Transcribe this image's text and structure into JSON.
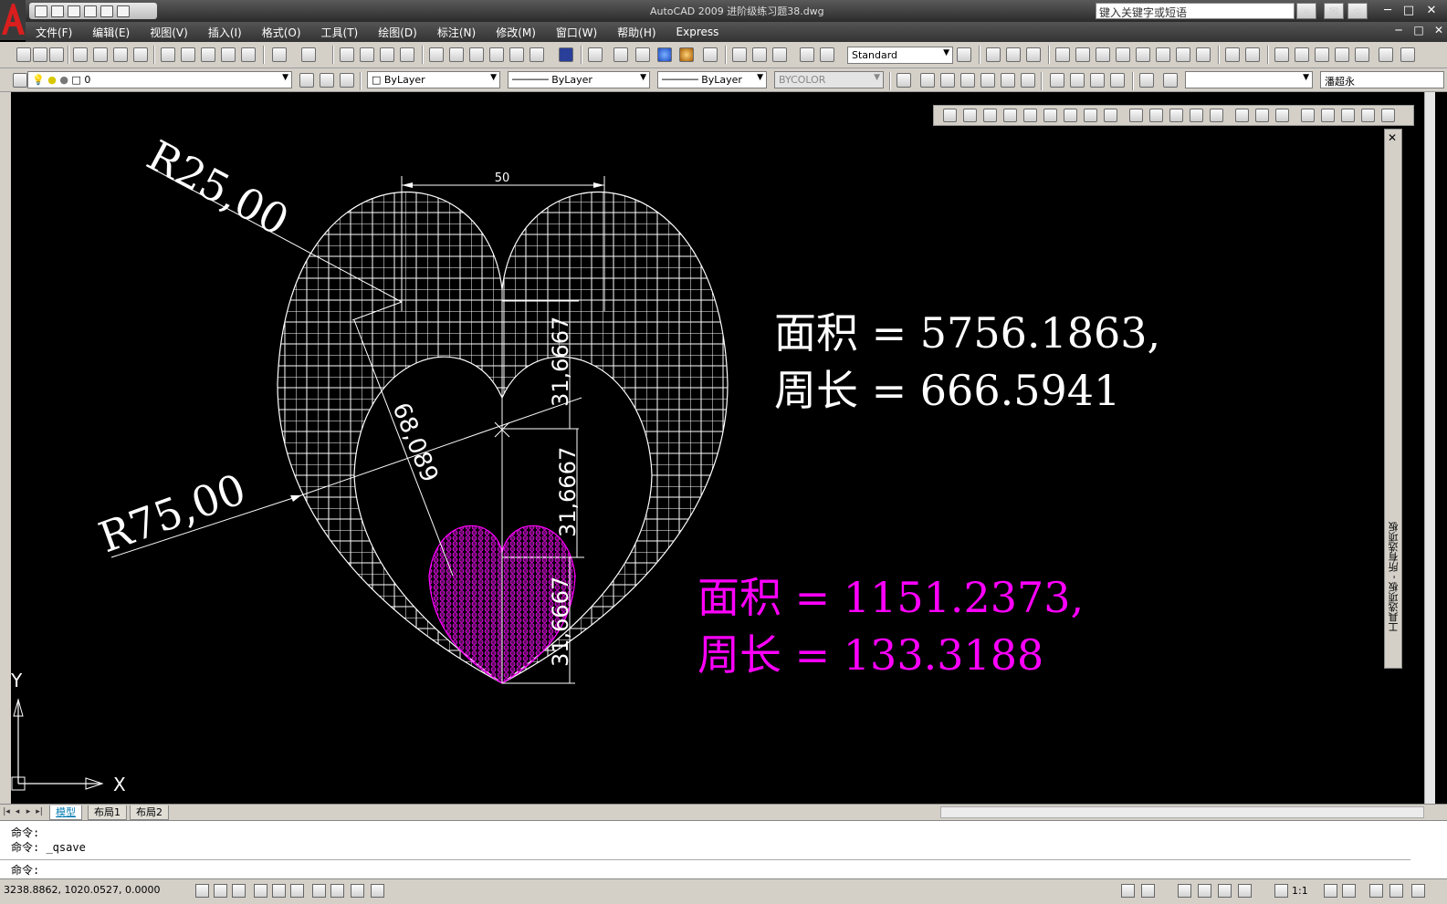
{
  "window": {
    "title": "AutoCAD 2009  进阶级练习题38.dwg",
    "search_placeholder": "键入关键字或短语",
    "min_symbol": "─",
    "max_symbol": "□",
    "close_symbol": "✕"
  },
  "menu": {
    "items": [
      "文件(F)",
      "编辑(E)",
      "视图(V)",
      "插入(I)",
      "格式(O)",
      "工具(T)",
      "绘图(D)",
      "标注(N)",
      "修改(M)",
      "窗口(W)",
      "帮助(H)",
      "Express"
    ]
  },
  "toolbar": {
    "text_style": "Standard",
    "layer": "0",
    "color": "ByLayer",
    "linetype": "ByLayer",
    "lineweight": "ByLayer",
    "plotstyle": "BYCOLOR",
    "user_field": "潘超永"
  },
  "palette": {
    "title": "工具选项板 - 所有选项板"
  },
  "drawing": {
    "dimensions": {
      "top_width": "50",
      "r_small": "R25,00",
      "r_large": "R75,00",
      "diag": "68,089",
      "v1": "31,6667",
      "v2": "31,6667",
      "v3": "31,6667"
    },
    "annotation_large": {
      "area": "面积 = 5756.1863,",
      "perimeter": "周长 = 666.5941"
    },
    "annotation_small": {
      "area": "面积 = 1151.2373,",
      "perimeter": "周长 = 133.3188"
    },
    "ucs": {
      "x_label": "X",
      "y_label": "Y"
    },
    "colors": {
      "line": "#ffffff",
      "magenta": "#ff00ff"
    }
  },
  "layout_tabs": [
    "模型",
    "布局1",
    "布局2"
  ],
  "command": {
    "line1": "命令:",
    "line2": "命令: _qsave",
    "prompt": "命令:"
  },
  "status": {
    "coordinates": "3238.8862, 1020.0527, 0.0000",
    "scale": "1:1"
  }
}
